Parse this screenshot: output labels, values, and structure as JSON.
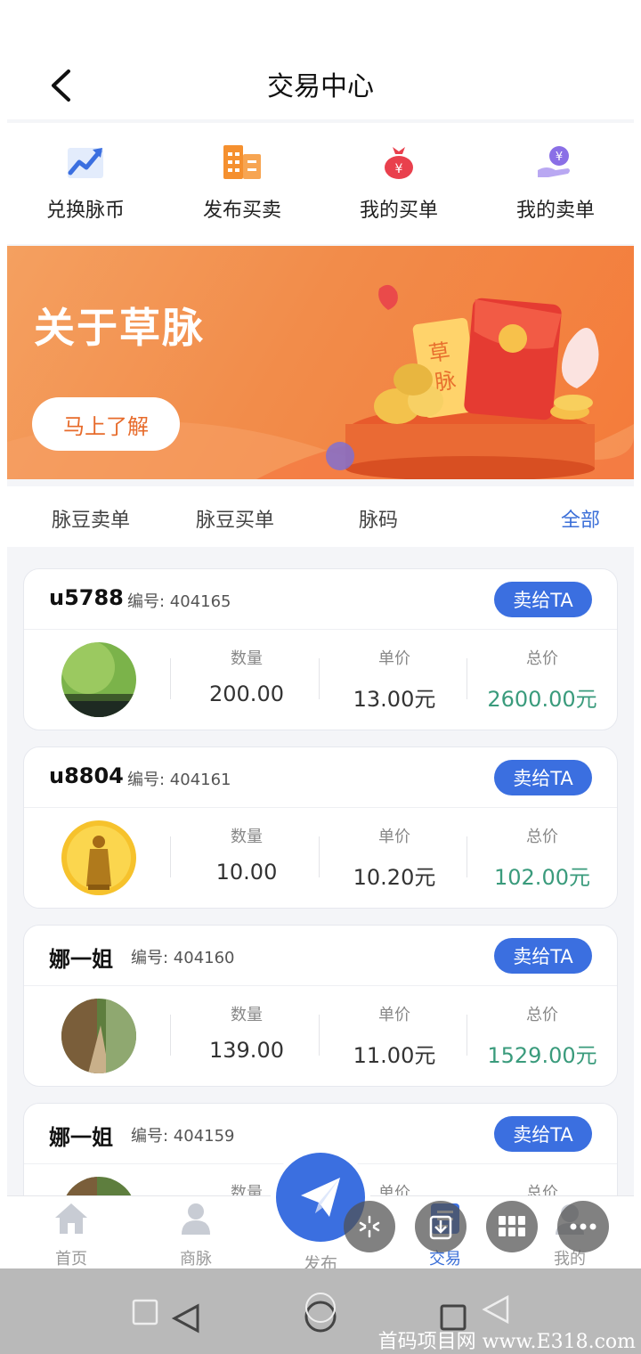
{
  "header": {
    "title": "交易中心"
  },
  "quick_actions": [
    {
      "label": "兑换脉币",
      "icon": "chart-up-icon",
      "color": "#3b6fe0"
    },
    {
      "label": "发布买卖",
      "icon": "building-icon",
      "color": "#f5902f"
    },
    {
      "label": "我的买单",
      "icon": "money-bag-icon",
      "color": "#e9404d"
    },
    {
      "label": "我的卖单",
      "icon": "hand-coin-icon",
      "color": "#8a6fe6"
    }
  ],
  "banner": {
    "title": "关于草脉",
    "button": "马上了解",
    "badge_text": "草脉"
  },
  "tabs": [
    "脉豆卖单",
    "脉豆买单",
    "脉码",
    "全部"
  ],
  "listing_labels": {
    "quantity": "数量",
    "unit_price": "单价",
    "total": "总价",
    "action": "卖给TA"
  },
  "listings": [
    {
      "user": "u5788",
      "number": "编号: 404165",
      "quantity": "200.00",
      "unit_price": "13.00元",
      "total": "2600.00元",
      "avatar": "green-landscape"
    },
    {
      "user": "u8804",
      "number": "编号: 404161",
      "quantity": "10.00",
      "unit_price": "10.20元",
      "total": "102.00元",
      "avatar": "golden-buddha"
    },
    {
      "user": "娜一姐",
      "number": "编号: 404160",
      "quantity": "139.00",
      "unit_price": "11.00元",
      "total": "1529.00元",
      "avatar": "forest-path"
    },
    {
      "user": "娜一姐",
      "number": "编号: 404159",
      "quantity": "",
      "unit_price": "",
      "total": "",
      "avatar": "forest-path"
    }
  ],
  "bottom_nav": [
    {
      "label": "首页",
      "icon": "home-icon"
    },
    {
      "label": "商脉",
      "icon": "person-icon"
    },
    {
      "label": "发布",
      "icon": "paper-plane-icon"
    },
    {
      "label": "交易",
      "icon": "trade-icon",
      "active": true
    },
    {
      "label": "我的",
      "icon": "profile-icon"
    }
  ],
  "watermark": "首码项目网 www.E318.com"
}
